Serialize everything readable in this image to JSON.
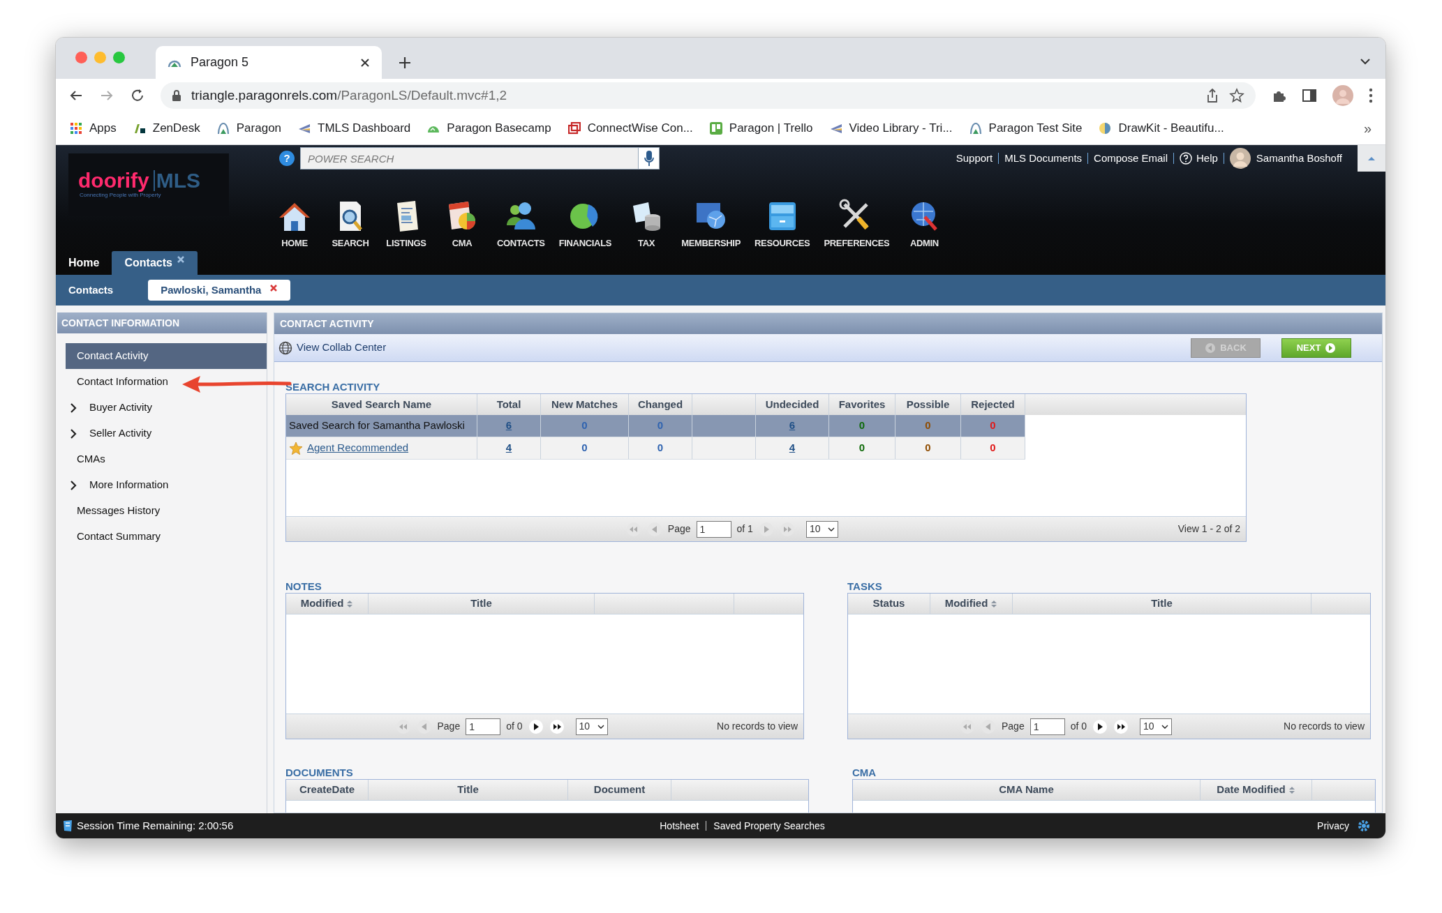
{
  "browser": {
    "tab_title": "Paragon 5",
    "url_host": "triangle.paragonrels.com",
    "url_path": "/ParagonLS/Default.mvc#1,2",
    "bookmarks": [
      "Apps",
      "ZenDesk",
      "Paragon",
      "TMLS Dashboard",
      "Paragon Basecamp",
      "ConnectWise Con...",
      "Paragon | Trello",
      "Video Library - Tri...",
      "Paragon Test Site",
      "DrawKit - Beautifu..."
    ],
    "more": "»"
  },
  "app": {
    "logo_word": "doorify",
    "logo_mls": "MLS",
    "logo_tagline": "Connecting People with Property",
    "help_mark": "?",
    "search_placeholder": "POWER SEARCH",
    "top_links": [
      "Support",
      "MLS Documents",
      "Compose Email",
      "Help"
    ],
    "user_name": "Samantha Boshoff",
    "nav": [
      "HOME",
      "SEARCH",
      "LISTINGS",
      "CMA",
      "CONTACTS",
      "FINANCIALS",
      "TAX",
      "MEMBERSHIP",
      "RESOURCES",
      "PREFERENCES",
      "ADMIN"
    ],
    "tabs": [
      {
        "label": "Home",
        "selected": false,
        "closable": false
      },
      {
        "label": "Contacts",
        "selected": true,
        "closable": true
      }
    ],
    "subtabs": [
      {
        "label": "Contacts",
        "selected": false,
        "closable": false
      },
      {
        "label": "Pawloski, Samantha",
        "selected": true,
        "closable": true
      }
    ]
  },
  "sidebar": {
    "title": "CONTACT INFORMATION",
    "items": [
      {
        "label": "Contact Activity",
        "kind": "link",
        "selected": true
      },
      {
        "label": "Contact Information",
        "kind": "link",
        "selected": false
      },
      {
        "label": "Buyer Activity",
        "kind": "group",
        "selected": false
      },
      {
        "label": "Seller Activity",
        "kind": "group",
        "selected": false
      },
      {
        "label": "CMAs",
        "kind": "link",
        "selected": false
      },
      {
        "label": "More Information",
        "kind": "group",
        "selected": false
      },
      {
        "label": "Messages History",
        "kind": "link",
        "selected": false
      },
      {
        "label": "Contact Summary",
        "kind": "link",
        "selected": false
      }
    ]
  },
  "main": {
    "title": "CONTACT ACTIVITY",
    "collab_link": "View Collab Center",
    "back": {
      "label": "BACK",
      "disabled": true
    },
    "next": {
      "label": "NEXT",
      "disabled": false
    },
    "search_activity": {
      "title": "SEARCH ACTIVITY",
      "columns": [
        "Saved Search Name",
        "Total",
        "New Matches",
        "Changed",
        "Undecided",
        "Favorites",
        "Possible",
        "Rejected"
      ],
      "rows": [
        {
          "name": "Saved Search for Samantha Pawloski",
          "starred": false,
          "selected": true,
          "values": [
            "6",
            "0",
            "0",
            "6",
            "0",
            "0",
            "0"
          ]
        },
        {
          "name": "Agent Recommended",
          "starred": true,
          "selected": false,
          "values": [
            "4",
            "0",
            "0",
            "4",
            "0",
            "0",
            "0"
          ]
        }
      ],
      "pager": {
        "page_label": "Page",
        "page": "1",
        "of": "of 1",
        "size": "10",
        "info": "View 1 - 2 of 2"
      }
    },
    "notes": {
      "title": "NOTES",
      "columns": [
        {
          "label": "Modified",
          "sortable": true
        },
        {
          "label": "Title",
          "sortable": false
        }
      ],
      "pager": {
        "page_label": "Page",
        "page": "1",
        "of": "of 0",
        "size": "10",
        "info": "No records to view"
      }
    },
    "tasks": {
      "title": "TASKS",
      "columns": [
        {
          "label": "Status",
          "sortable": false
        },
        {
          "label": "Modified",
          "sortable": true
        },
        {
          "label": "Title",
          "sortable": false
        }
      ],
      "pager": {
        "page_label": "Page",
        "page": "1",
        "of": "of 0",
        "size": "10",
        "info": "No records to view"
      }
    },
    "documents": {
      "title": "DOCUMENTS",
      "columns": [
        {
          "label": "CreateDate",
          "sortable": false
        },
        {
          "label": "Title",
          "sortable": false
        },
        {
          "label": "Document",
          "sortable": false
        }
      ]
    },
    "cma": {
      "title": "CMA",
      "columns": [
        {
          "label": "CMA Name",
          "sortable": false
        },
        {
          "label": "Date Modified",
          "sortable": true
        }
      ]
    }
  },
  "footer": {
    "session": "Session Time Remaining: 2:00:56",
    "links": [
      "Hotsheet",
      "Saved Property Searches"
    ],
    "privacy": "Privacy"
  }
}
